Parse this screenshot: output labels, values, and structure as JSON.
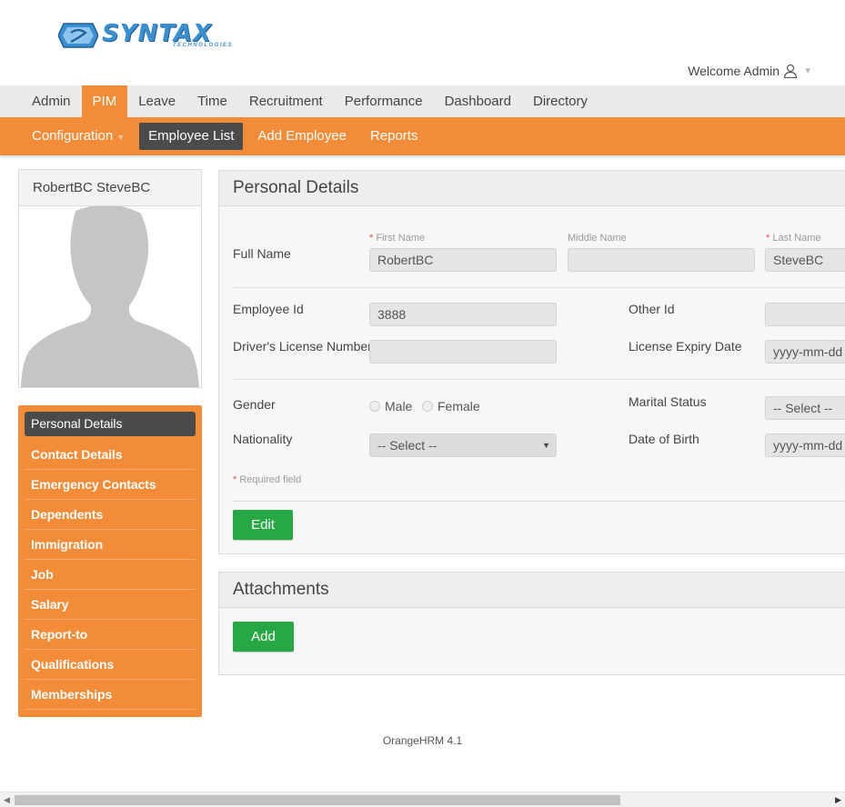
{
  "brand": {
    "name": "SYNTAX",
    "sub": "TECHNOLOGIES",
    "color": "#3a8fd0"
  },
  "header": {
    "welcome": "Welcome Admin"
  },
  "topnav": [
    "Admin",
    "PIM",
    "Leave",
    "Time",
    "Recruitment",
    "Performance",
    "Dashboard",
    "Directory"
  ],
  "topnav_active": "PIM",
  "subnav": {
    "configuration": "Configuration",
    "employee_list": "Employee List",
    "add_employee": "Add Employee",
    "reports": "Reports"
  },
  "profile": {
    "name": "RobertBC SteveBC"
  },
  "sidemenu": [
    "Personal Details",
    "Contact Details",
    "Emergency Contacts",
    "Dependents",
    "Immigration",
    "Job",
    "Salary",
    "Report-to",
    "Qualifications",
    "Memberships"
  ],
  "personal": {
    "title": "Personal Details",
    "full_name_label": "Full Name",
    "first_name_label": "First Name",
    "middle_name_label": "Middle Name",
    "last_name_label": "Last Name",
    "first_name": "RobertBC",
    "middle_name": "",
    "last_name": "SteveBC",
    "employee_id_label": "Employee Id",
    "employee_id": "3888",
    "other_id_label": "Other Id",
    "other_id": "",
    "license_label": "Driver's License Number",
    "license": "",
    "license_expiry_label": "License Expiry Date",
    "license_expiry": "yyyy-mm-dd",
    "gender_label": "Gender",
    "gender_male": "Male",
    "gender_female": "Female",
    "marital_label": "Marital Status",
    "marital_value": "-- Select --",
    "nationality_label": "Nationality",
    "nationality_value": "-- Select --",
    "dob_label": "Date of Birth",
    "dob": "yyyy-mm-dd",
    "required_note": "Required field",
    "edit_label": "Edit"
  },
  "attachments": {
    "title": "Attachments",
    "add_label": "Add"
  },
  "footer": {
    "text": "OrangeHRM 4.1"
  },
  "colors": {
    "accent": "#f28c38",
    "dark": "#4b4b4b",
    "green": "#28a745"
  }
}
